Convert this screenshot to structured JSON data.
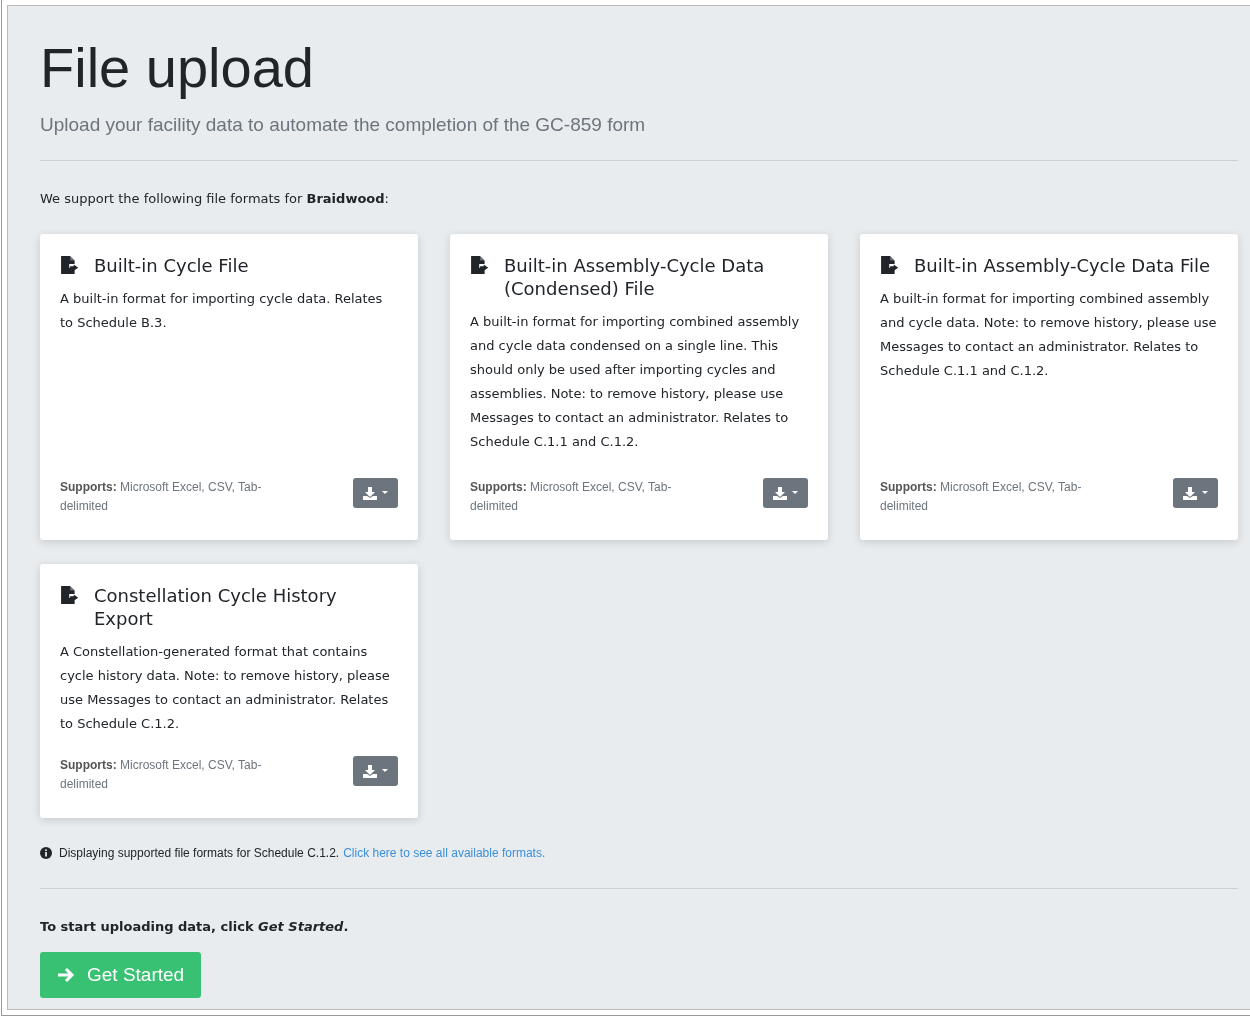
{
  "header": {
    "title": "File upload",
    "subtitle": "Upload your facility data to automate the completion of the GC-859 form"
  },
  "intro": "We support the following file formats for **Braidwood**:",
  "formats": [
    {
      "title": "Built-in Cycle File",
      "description": "A built-in format for importing cycle data. Relates to Schedule B.3.",
      "supports_label": "Supports:",
      "supports": "Microsoft Excel, CSV, Tab-delimited"
    },
    {
      "title": "Built-in Assembly-Cycle Data (Condensed) File",
      "description": "A built-in format for importing combined assembly and cycle data condensed on a single line. This should only be used after importing cycles and assemblies. Note: to remove history, please use Messages to contact an administrator. Relates to Schedule C.1.1 and C.1.2.",
      "supports_label": "Supports:",
      "supports": "Microsoft Excel, CSV, Tab-delimited"
    },
    {
      "title": "Built-in Assembly-Cycle Data File",
      "description": "A built-in format for importing combined assembly and cycle data. Note: to remove history, please use Messages to contact an administrator. Relates to Schedule C.1.1 and C.1.2.",
      "supports_label": "Supports:",
      "supports": "Microsoft Excel, CSV, Tab-delimited"
    },
    {
      "title": "Constellation Cycle History Export",
      "description": "A Constellation-generated format that contains cycle history data. Note: to remove history, please use Messages to contact an administrator. Relates to Schedule C.1.2.",
      "supports_label": "Supports:",
      "supports": "Microsoft Excel, CSV, Tab-delimited"
    }
  ],
  "notice": {
    "text": "Displaying supported file formats for Schedule C.1.2.",
    "link": "Click here to see all available formats."
  },
  "start_text": "To start uploading data, click *Get Started*.",
  "start_button": "Get Started"
}
